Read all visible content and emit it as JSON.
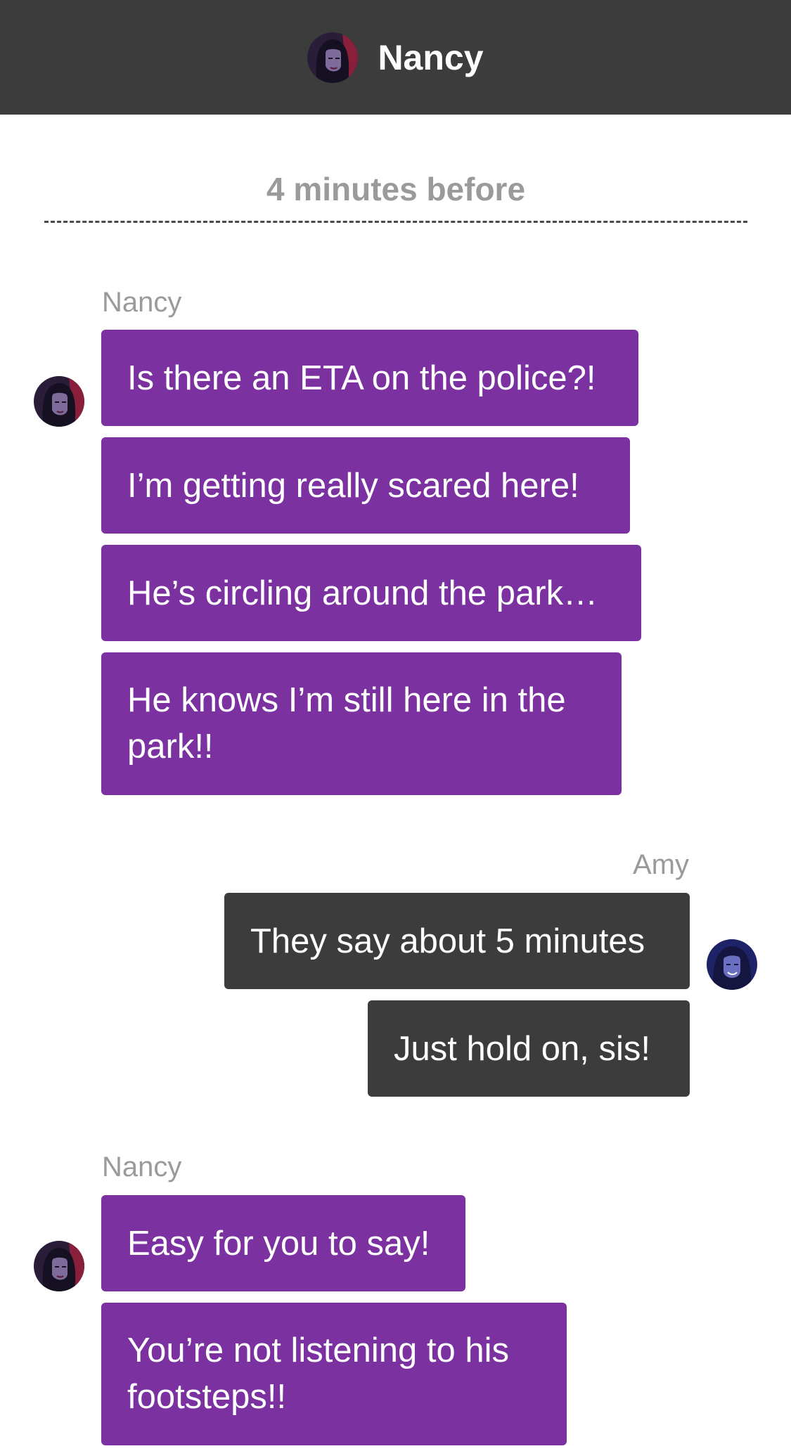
{
  "header": {
    "title": "Nancy",
    "avatar_icon": "nancy-avatar-icon"
  },
  "divider": {
    "label": "4 minutes before"
  },
  "groups": [
    {
      "sender": "Nancy",
      "messages": [
        "Is there an ETA on the police?!",
        "I’m getting really scared here!",
        "He’s circling around the park…",
        "He knows I’m still here in the park!!"
      ]
    },
    {
      "sender": "Amy",
      "messages": [
        "They say about 5 minutes",
        "Just hold on, sis!"
      ]
    },
    {
      "sender": "Nancy",
      "messages": [
        "Easy for you to say!",
        "You’re not listening to his footsteps!!"
      ]
    }
  ],
  "colors": {
    "header_bg": "#3c3c3c",
    "nancy_bubble": "#7b31a0",
    "amy_bubble": "#3c3c3c",
    "muted_text": "#9a9a9a"
  }
}
